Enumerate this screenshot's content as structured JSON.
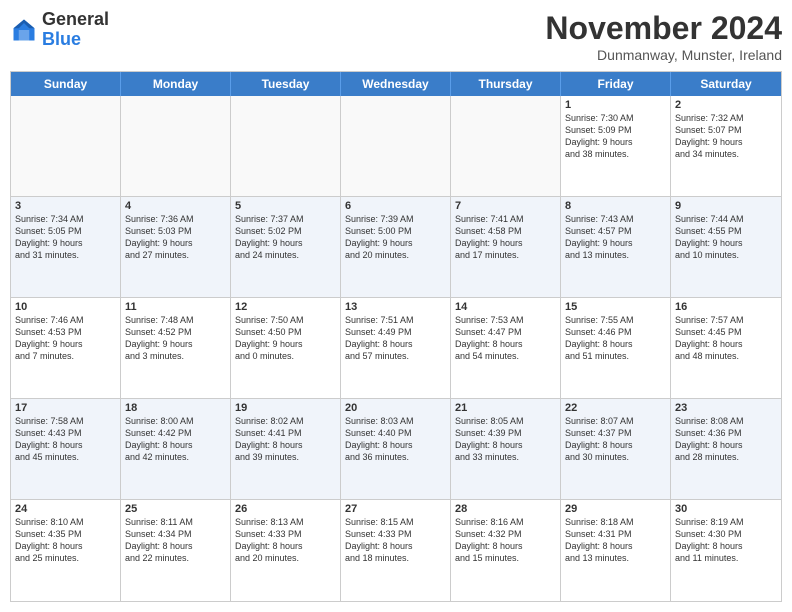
{
  "header": {
    "logo_general": "General",
    "logo_blue": "Blue",
    "month_title": "November 2024",
    "location": "Dunmanway, Munster, Ireland"
  },
  "weekdays": [
    "Sunday",
    "Monday",
    "Tuesday",
    "Wednesday",
    "Thursday",
    "Friday",
    "Saturday"
  ],
  "rows": [
    [
      {
        "day": "",
        "info": ""
      },
      {
        "day": "",
        "info": ""
      },
      {
        "day": "",
        "info": ""
      },
      {
        "day": "",
        "info": ""
      },
      {
        "day": "",
        "info": ""
      },
      {
        "day": "1",
        "info": "Sunrise: 7:30 AM\nSunset: 5:09 PM\nDaylight: 9 hours\nand 38 minutes."
      },
      {
        "day": "2",
        "info": "Sunrise: 7:32 AM\nSunset: 5:07 PM\nDaylight: 9 hours\nand 34 minutes."
      }
    ],
    [
      {
        "day": "3",
        "info": "Sunrise: 7:34 AM\nSunset: 5:05 PM\nDaylight: 9 hours\nand 31 minutes."
      },
      {
        "day": "4",
        "info": "Sunrise: 7:36 AM\nSunset: 5:03 PM\nDaylight: 9 hours\nand 27 minutes."
      },
      {
        "day": "5",
        "info": "Sunrise: 7:37 AM\nSunset: 5:02 PM\nDaylight: 9 hours\nand 24 minutes."
      },
      {
        "day": "6",
        "info": "Sunrise: 7:39 AM\nSunset: 5:00 PM\nDaylight: 9 hours\nand 20 minutes."
      },
      {
        "day": "7",
        "info": "Sunrise: 7:41 AM\nSunset: 4:58 PM\nDaylight: 9 hours\nand 17 minutes."
      },
      {
        "day": "8",
        "info": "Sunrise: 7:43 AM\nSunset: 4:57 PM\nDaylight: 9 hours\nand 13 minutes."
      },
      {
        "day": "9",
        "info": "Sunrise: 7:44 AM\nSunset: 4:55 PM\nDaylight: 9 hours\nand 10 minutes."
      }
    ],
    [
      {
        "day": "10",
        "info": "Sunrise: 7:46 AM\nSunset: 4:53 PM\nDaylight: 9 hours\nand 7 minutes."
      },
      {
        "day": "11",
        "info": "Sunrise: 7:48 AM\nSunset: 4:52 PM\nDaylight: 9 hours\nand 3 minutes."
      },
      {
        "day": "12",
        "info": "Sunrise: 7:50 AM\nSunset: 4:50 PM\nDaylight: 9 hours\nand 0 minutes."
      },
      {
        "day": "13",
        "info": "Sunrise: 7:51 AM\nSunset: 4:49 PM\nDaylight: 8 hours\nand 57 minutes."
      },
      {
        "day": "14",
        "info": "Sunrise: 7:53 AM\nSunset: 4:47 PM\nDaylight: 8 hours\nand 54 minutes."
      },
      {
        "day": "15",
        "info": "Sunrise: 7:55 AM\nSunset: 4:46 PM\nDaylight: 8 hours\nand 51 minutes."
      },
      {
        "day": "16",
        "info": "Sunrise: 7:57 AM\nSunset: 4:45 PM\nDaylight: 8 hours\nand 48 minutes."
      }
    ],
    [
      {
        "day": "17",
        "info": "Sunrise: 7:58 AM\nSunset: 4:43 PM\nDaylight: 8 hours\nand 45 minutes."
      },
      {
        "day": "18",
        "info": "Sunrise: 8:00 AM\nSunset: 4:42 PM\nDaylight: 8 hours\nand 42 minutes."
      },
      {
        "day": "19",
        "info": "Sunrise: 8:02 AM\nSunset: 4:41 PM\nDaylight: 8 hours\nand 39 minutes."
      },
      {
        "day": "20",
        "info": "Sunrise: 8:03 AM\nSunset: 4:40 PM\nDaylight: 8 hours\nand 36 minutes."
      },
      {
        "day": "21",
        "info": "Sunrise: 8:05 AM\nSunset: 4:39 PM\nDaylight: 8 hours\nand 33 minutes."
      },
      {
        "day": "22",
        "info": "Sunrise: 8:07 AM\nSunset: 4:37 PM\nDaylight: 8 hours\nand 30 minutes."
      },
      {
        "day": "23",
        "info": "Sunrise: 8:08 AM\nSunset: 4:36 PM\nDaylight: 8 hours\nand 28 minutes."
      }
    ],
    [
      {
        "day": "24",
        "info": "Sunrise: 8:10 AM\nSunset: 4:35 PM\nDaylight: 8 hours\nand 25 minutes."
      },
      {
        "day": "25",
        "info": "Sunrise: 8:11 AM\nSunset: 4:34 PM\nDaylight: 8 hours\nand 22 minutes."
      },
      {
        "day": "26",
        "info": "Sunrise: 8:13 AM\nSunset: 4:33 PM\nDaylight: 8 hours\nand 20 minutes."
      },
      {
        "day": "27",
        "info": "Sunrise: 8:15 AM\nSunset: 4:33 PM\nDaylight: 8 hours\nand 18 minutes."
      },
      {
        "day": "28",
        "info": "Sunrise: 8:16 AM\nSunset: 4:32 PM\nDaylight: 8 hours\nand 15 minutes."
      },
      {
        "day": "29",
        "info": "Sunrise: 8:18 AM\nSunset: 4:31 PM\nDaylight: 8 hours\nand 13 minutes."
      },
      {
        "day": "30",
        "info": "Sunrise: 8:19 AM\nSunset: 4:30 PM\nDaylight: 8 hours\nand 11 minutes."
      }
    ]
  ]
}
